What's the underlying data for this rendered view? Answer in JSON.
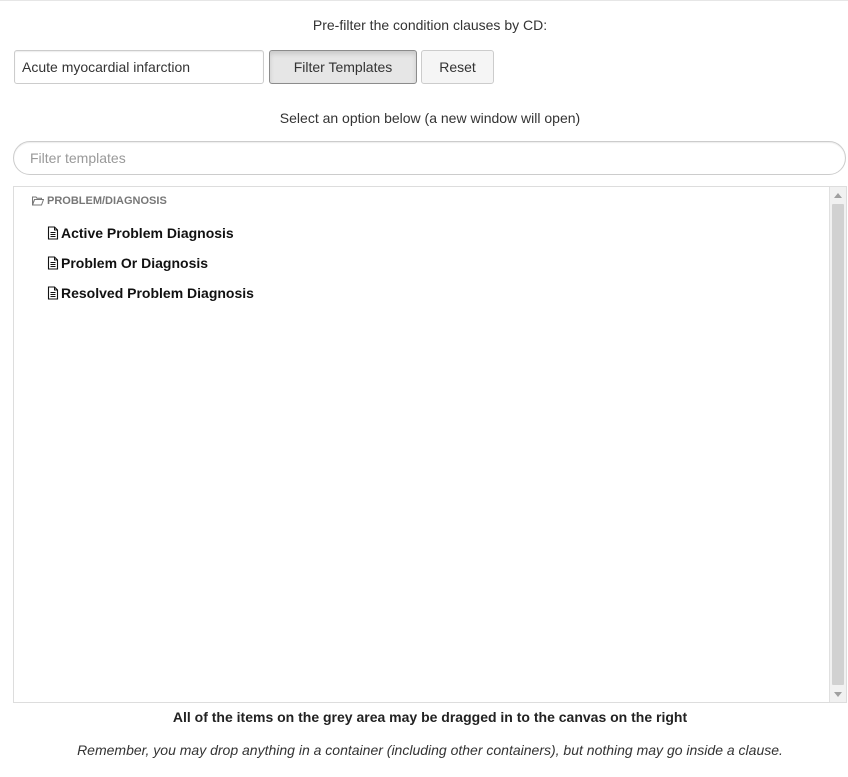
{
  "prefilter": {
    "label": "Pre-filter the condition clauses by CD:",
    "input_value": "Acute myocardial infarction",
    "filter_button": "Filter Templates",
    "reset_button": "Reset"
  },
  "select_label": "Select an option below (a new window will open)",
  "search": {
    "placeholder": "Filter templates"
  },
  "tree": {
    "folder": {
      "icon": "folder-open-icon",
      "label": "PROBLEM/DIAGNOSIS"
    },
    "items": [
      {
        "icon": "document-icon",
        "label": "Active Problem Diagnosis"
      },
      {
        "icon": "document-icon",
        "label": "Problem Or Diagnosis"
      },
      {
        "icon": "document-icon",
        "label": "Resolved Problem Diagnosis"
      }
    ]
  },
  "footer": {
    "hint": "All of the items on the grey area may be dragged in to the canvas on the right",
    "remember": "Remember, you may drop anything in a container (including other containers), but nothing may go inside a clause."
  }
}
